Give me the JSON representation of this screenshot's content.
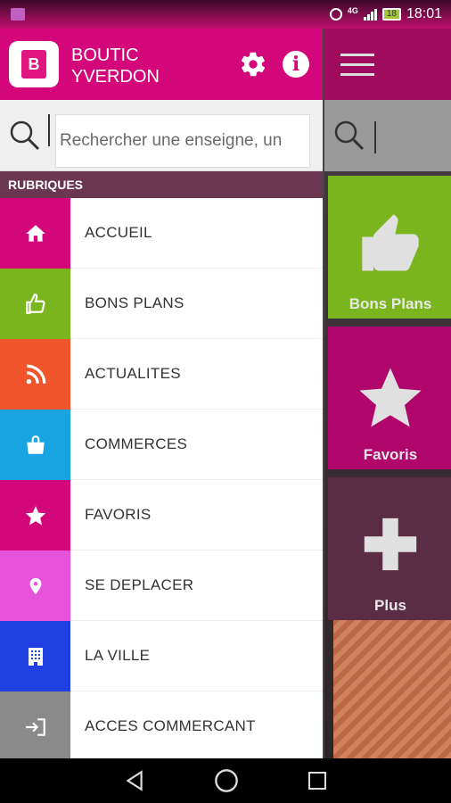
{
  "status_bar": {
    "network": "4G",
    "battery": "18",
    "time": "18:01"
  },
  "drawer": {
    "app_title_line1": "BOUTIC",
    "app_title_line2": "YVERDON",
    "app_icon_letter": "B",
    "search_placeholder": "Rechercher une enseigne, un",
    "section_label": "RUBRIQUES",
    "items": [
      {
        "label": "ACCUEIL",
        "icon": "home-icon",
        "color": "#d4077a"
      },
      {
        "label": "BONS PLANS",
        "icon": "thumbs-up-icon",
        "color": "#7ab51d"
      },
      {
        "label": "ACTUALITES",
        "icon": "rss-icon",
        "color": "#f0542b"
      },
      {
        "label": "COMMERCES",
        "icon": "shopping-bag-icon",
        "color": "#17a4e0"
      },
      {
        "label": "FAVORIS",
        "icon": "star-icon",
        "color": "#d4077a"
      },
      {
        "label": "SE DEPLACER",
        "icon": "map-pin-icon",
        "color": "#e652d9"
      },
      {
        "label": "LA VILLE",
        "icon": "building-icon",
        "color": "#1f3fe0"
      },
      {
        "label": "ACCES COMMERCANT",
        "icon": "sign-in-icon",
        "color": "#8a8a8a"
      }
    ]
  },
  "background": {
    "tiles": [
      {
        "label": "Bons Plans",
        "icon": "thumbs-up-icon",
        "color": "#7ab51d"
      },
      {
        "label": "Favoris",
        "icon": "star-icon",
        "color": "#b0066b"
      },
      {
        "label": "Plus",
        "icon": "plus-icon",
        "color": "#5b2d45"
      }
    ]
  },
  "colors": {
    "brand": "#d4077a",
    "section": "#6b3650"
  }
}
